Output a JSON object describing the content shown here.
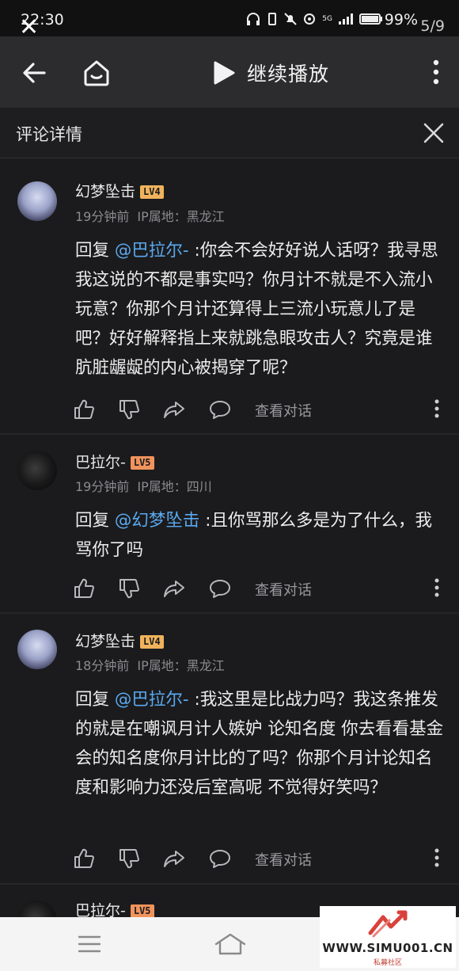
{
  "status_bar": {
    "time": "22:30",
    "battery": "99%",
    "page_counter": "5/9",
    "network": "5G"
  },
  "top_bar": {
    "continue_label": "继续播放"
  },
  "sub_header": {
    "title": "评论详情"
  },
  "comments": [
    {
      "user": "幻梦坠击",
      "level": "LV4",
      "time": "19分钟前",
      "ip": "IP属地：黑龙江",
      "reply_prefix": "回复",
      "mention": "@巴拉尔-",
      "text": ":你会不会好好说人话呀？我寻思我这说的不都是事实吗？你月计不就是不入流小玩意？你那个月计还算得上三流小玩意儿了是吧？好好解释指上来就跳急眼攻击人？究竟是谁肮脏龌龊的内心被揭穿了呢？",
      "view_dialog": "查看对话"
    },
    {
      "user": "巴拉尔-",
      "level": "LV5",
      "time": "19分钟前",
      "ip": "IP属地：四川",
      "reply_prefix": "回复",
      "mention": "@幻梦坠击",
      "text": ":且你骂那么多是为了什么，我骂你了吗",
      "view_dialog": "查看对话"
    },
    {
      "user": "幻梦坠击",
      "level": "LV4",
      "time": "18分钟前",
      "ip": "IP属地：黑龙江",
      "reply_prefix": "回复",
      "mention": "@巴拉尔-",
      "text": ":我这里是比战力吗？我这条推发的就是在嘲讽月计人嫉妒 论知名度 你去看看基金会的知名度你月计比的了吗？你那个月计论知名度和影响力还没后室高呢 不觉得好笑吗？",
      "view_dialog": "查看对话"
    },
    {
      "user": "巴拉尔-",
      "level": "LV5"
    }
  ],
  "watermark": {
    "url": "WWW.SIMU001.CN",
    "sub": "私募社区"
  },
  "colors": {
    "background": "#1b1b1d",
    "mention": "#5aa9f0",
    "lv4": "#f0b35c",
    "lv5": "#f0935c"
  }
}
